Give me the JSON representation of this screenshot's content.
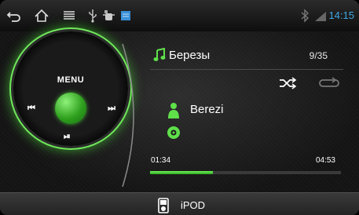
{
  "status_bar": {
    "time": "14:15",
    "icons": [
      "back-icon",
      "home-icon",
      "menu-icon",
      "usb-icon",
      "android-debug-icon",
      "storage-icon",
      "bluetooth-icon",
      "signal-icon"
    ]
  },
  "wheel": {
    "menu_label": "MENU",
    "prev_glyph": "⏮",
    "next_glyph": "⏭",
    "play_pause_glyph": "⏯"
  },
  "track": {
    "title": "Березы",
    "count": "9/35",
    "artist": "Berezi",
    "time_current": "01:34",
    "time_total": "04:53",
    "progress": 0.33
  },
  "source": {
    "label": "iPOD"
  },
  "colors": {
    "accent": "#5fe04a",
    "clock": "#3fa8e6"
  }
}
